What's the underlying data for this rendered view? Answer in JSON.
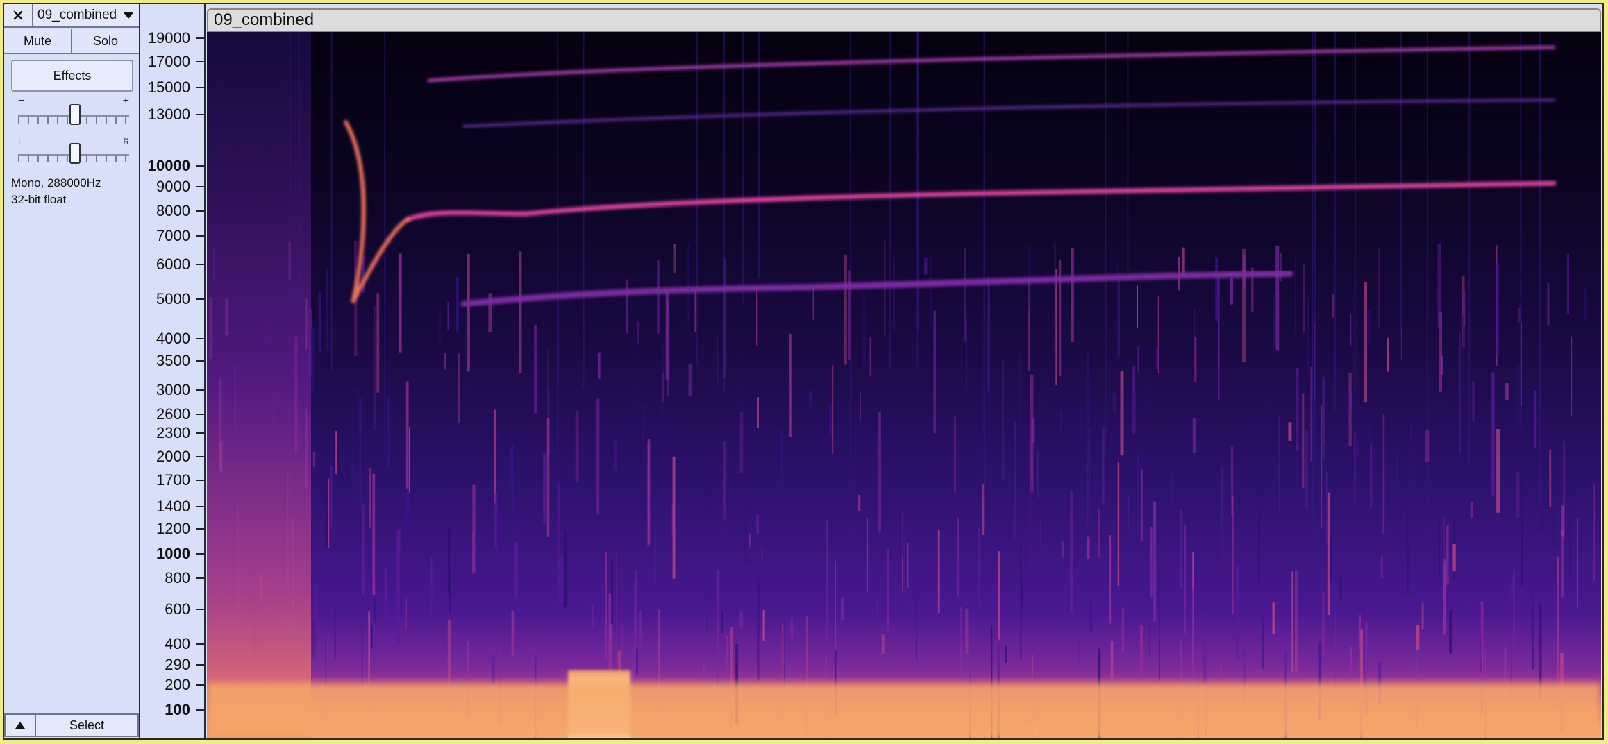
{
  "track": {
    "name": "09_combined",
    "mute_label": "Mute",
    "solo_label": "Solo",
    "effects_label": "Effects",
    "gain": {
      "minus": "−",
      "plus": "+"
    },
    "pan": {
      "left": "L",
      "right": "R"
    },
    "info_line1": "Mono, 288000Hz",
    "info_line2": "32-bit float",
    "select_label": "Select"
  },
  "clip": {
    "title": "09_combined"
  },
  "ruler": {
    "ticks": [
      "19000",
      "17000",
      "15000",
      "13000",
      "10000",
      "9000",
      "8000",
      "7000",
      "6000",
      "5000",
      "4000",
      "3500",
      "3000",
      "2600",
      "2300",
      "2000",
      "1700",
      "1400",
      "1200",
      "1000",
      "800",
      "600",
      "400",
      "290",
      "200",
      "100"
    ],
    "bold_ticks": [
      "10000",
      "1000",
      "100"
    ]
  },
  "colors": {
    "background": "#f3ec86",
    "panel": "#d7e0f8",
    "spectrogram_low": "#05020e",
    "spectrogram_high": "#fff3c0"
  },
  "icons": [
    "close-icon",
    "dropdown-arrow-icon",
    "collapse-arrow-icon"
  ]
}
